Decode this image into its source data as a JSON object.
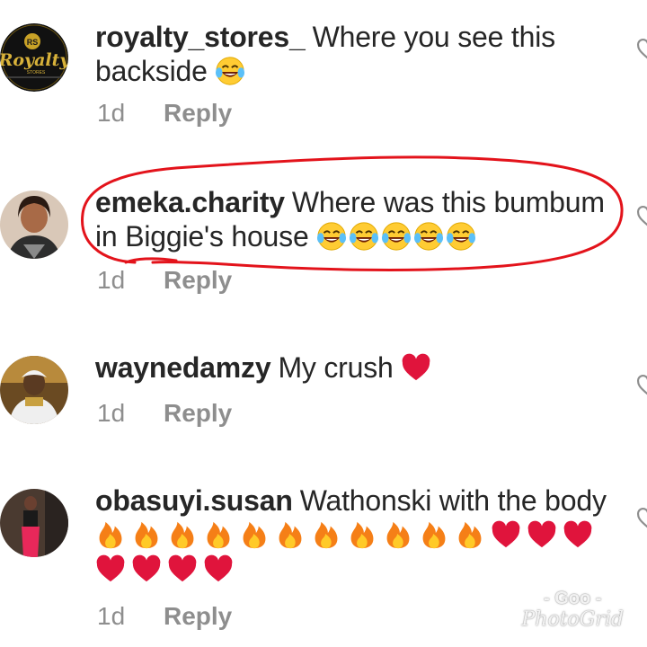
{
  "comments": [
    {
      "username": "royalty_stores_",
      "text": "Where you see this backside",
      "emojis": [
        "joy"
      ],
      "time": "1d",
      "reply_label": "Reply",
      "avatar": {
        "kind": "logo",
        "logo_text": "Royalty",
        "logo_sub": "STORES",
        "badge_text": "RS"
      }
    },
    {
      "username": "emeka.charity",
      "text": "Where was this bumbum in Biggie's house",
      "emojis": [
        "joy",
        "joy",
        "joy",
        "joy",
        "joy"
      ],
      "time": "1d",
      "reply_label": "Reply",
      "avatar": {
        "kind": "photo"
      }
    },
    {
      "username": "waynedamzy",
      "text": "⁣My crush",
      "emojis": [
        "heart"
      ],
      "time": "1d",
      "reply_label": "Reply",
      "avatar": {
        "kind": "photo"
      }
    },
    {
      "username": "obasuyi.susan",
      "text": "Wathonski with the body",
      "emojis": [
        "fire",
        "fire",
        "fire",
        "fire",
        "fire",
        "fire",
        "fire",
        "fire",
        "fire",
        "fire",
        "fire",
        "heart",
        "heart",
        "heart",
        "heart",
        "heart",
        "heart",
        "heart"
      ],
      "time": "1d",
      "reply_label": "Reply",
      "avatar": {
        "kind": "photo"
      }
    }
  ],
  "watermark": {
    "line1": "- Goo -",
    "line2": "PhotoGrid"
  },
  "colors": {
    "username": "#262626",
    "meta": "#8e8e8e",
    "annotation": "#e3131b",
    "heart": "#e0143c",
    "fire": "#f57f17"
  },
  "icons": {
    "like": "heart-outline-icon",
    "emoji_joy": "face-with-tears-of-joy",
    "emoji_heart": "red-heart",
    "emoji_fire": "fire"
  }
}
